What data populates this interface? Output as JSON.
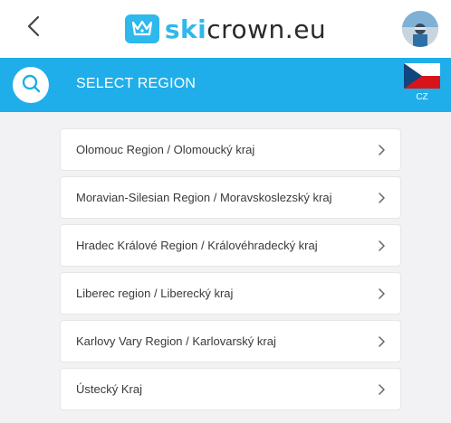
{
  "topbar": {
    "back_icon": "chevron-left-icon",
    "logo_icon": "crown-icon",
    "logo_ski": "ski",
    "logo_rest": "crown.eu",
    "brand_color": "#2eb8ec",
    "avatar": "user-avatar"
  },
  "header": {
    "title": "SELECT REGION",
    "search_icon": "search-icon",
    "language_code": "CZ",
    "background": "#1faee9"
  },
  "regions": [
    {
      "label": "Olomouc Region / Olomoucký kraj"
    },
    {
      "label": "Moravian-Silesian Region / Moravskoslezský kraj"
    },
    {
      "label": "Hradec Králové Region / Královéhradecký kraj"
    },
    {
      "label": "Liberec region / Liberecký kraj"
    },
    {
      "label": "Karlovy Vary Region / Karlovarský kraj"
    },
    {
      "label": "Ústecký Kraj"
    }
  ]
}
